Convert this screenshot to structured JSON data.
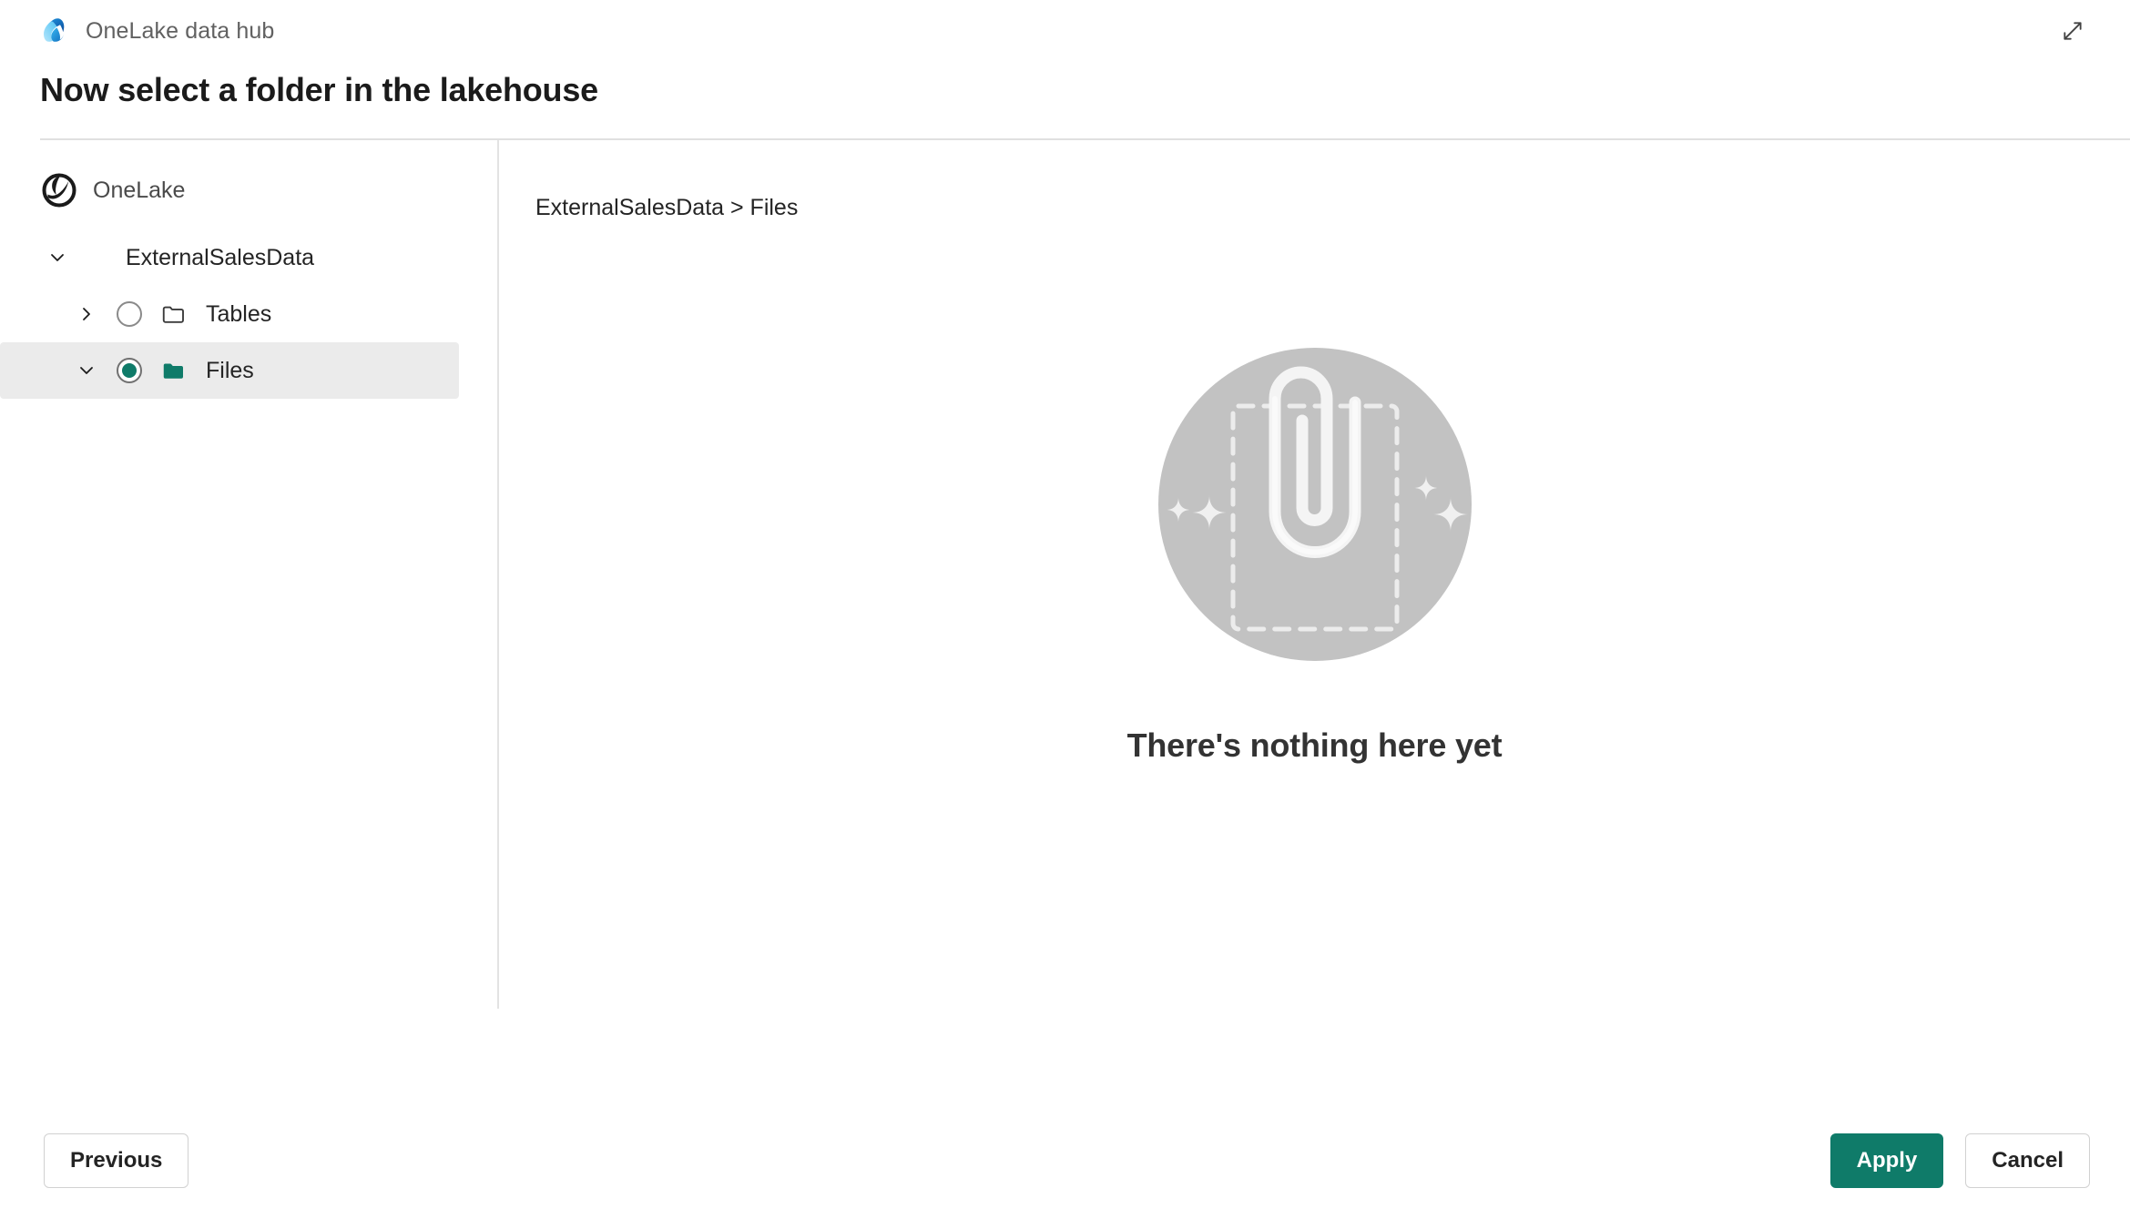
{
  "theme": {
    "accent_teal": "#0f7b69",
    "selected_row_bg": "#ebebeb",
    "divider": "#e0e0e0",
    "illustration_circle": "#c0c0c0",
    "illustration_white": "#f2f2f2"
  },
  "header": {
    "brand_title": "OneLake data hub",
    "brand_icon": "onelake-drop-logo",
    "expand_icon": "expand-diagonal-arrow-icon"
  },
  "page": {
    "heading": "Now select a folder in the lakehouse"
  },
  "sidebar": {
    "root": {
      "label": "OneLake",
      "icon": "onelake-circle-icon"
    },
    "tree": [
      {
        "label": "ExternalSalesData",
        "level": 0,
        "expanded": true,
        "chevron": "chevron-down-icon",
        "selectable": false,
        "selected": false
      },
      {
        "label": "Tables",
        "level": 1,
        "expanded": false,
        "chevron": "chevron-right-icon",
        "selectable": true,
        "selected": false,
        "folder_icon": "folder-outline-icon"
      },
      {
        "label": "Files",
        "level": 1,
        "expanded": true,
        "chevron": "chevron-down-icon",
        "selectable": true,
        "selected": true,
        "folder_icon": "folder-filled-icon"
      }
    ]
  },
  "main": {
    "breadcrumb": {
      "parts": [
        "ExternalSalesData",
        "Files"
      ],
      "separator": ">",
      "text": "ExternalSalesData > Files"
    },
    "empty_state": {
      "illustration": "paperclip-empty-folder-illustration",
      "message": "There's nothing here yet"
    }
  },
  "footer": {
    "previous_label": "Previous",
    "apply_label": "Apply",
    "cancel_label": "Cancel"
  }
}
